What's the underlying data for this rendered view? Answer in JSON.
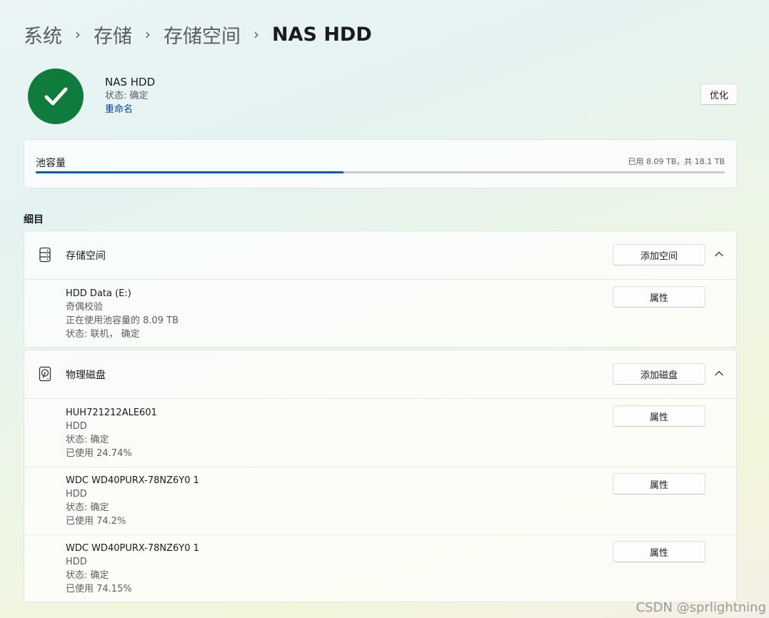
{
  "breadcrumb": {
    "items": [
      "系统",
      "存储",
      "存储空间",
      "NAS HDD"
    ],
    "separator": "›"
  },
  "pool": {
    "name": "NAS HDD",
    "status": "状态: 确定",
    "rename": "重命名",
    "optimize": "优化",
    "status_color": "#0f7b3d"
  },
  "capacity": {
    "label": "池容量",
    "text": "已用 8.09 TB，共 18.1 TB",
    "used_fraction": 0.447
  },
  "details_title": "细目",
  "storage_spaces": {
    "title": "存储空间",
    "add_button": "添加空间",
    "items": [
      {
        "name": "HDD Data (E:)",
        "resiliency": "奇偶校验",
        "usage": "正在使用池容量的 8.09 TB",
        "status": "状态: 联机， 确定",
        "props": "属性"
      }
    ]
  },
  "physical_disks": {
    "title": "物理磁盘",
    "add_button": "添加磁盘",
    "items": [
      {
        "name": "HUH721212ALE601",
        "type": "HDD",
        "status": "状态: 确定",
        "used": "已使用 24.74%",
        "props": "属性"
      },
      {
        "name": "WDC WD40PURX-78NZ6Y0  1",
        "type": "HDD",
        "status": "状态: 确定",
        "used": "已使用 74.2%",
        "props": "属性"
      },
      {
        "name": "WDC WD40PURX-78NZ6Y0  1",
        "type": "HDD",
        "status": "状态: 确定",
        "used": "已使用 74.15%",
        "props": "属性"
      }
    ]
  },
  "watermark": "CSDN @sprlightning",
  "colors": {
    "accent": "#005fb8",
    "link": "#003e92"
  }
}
